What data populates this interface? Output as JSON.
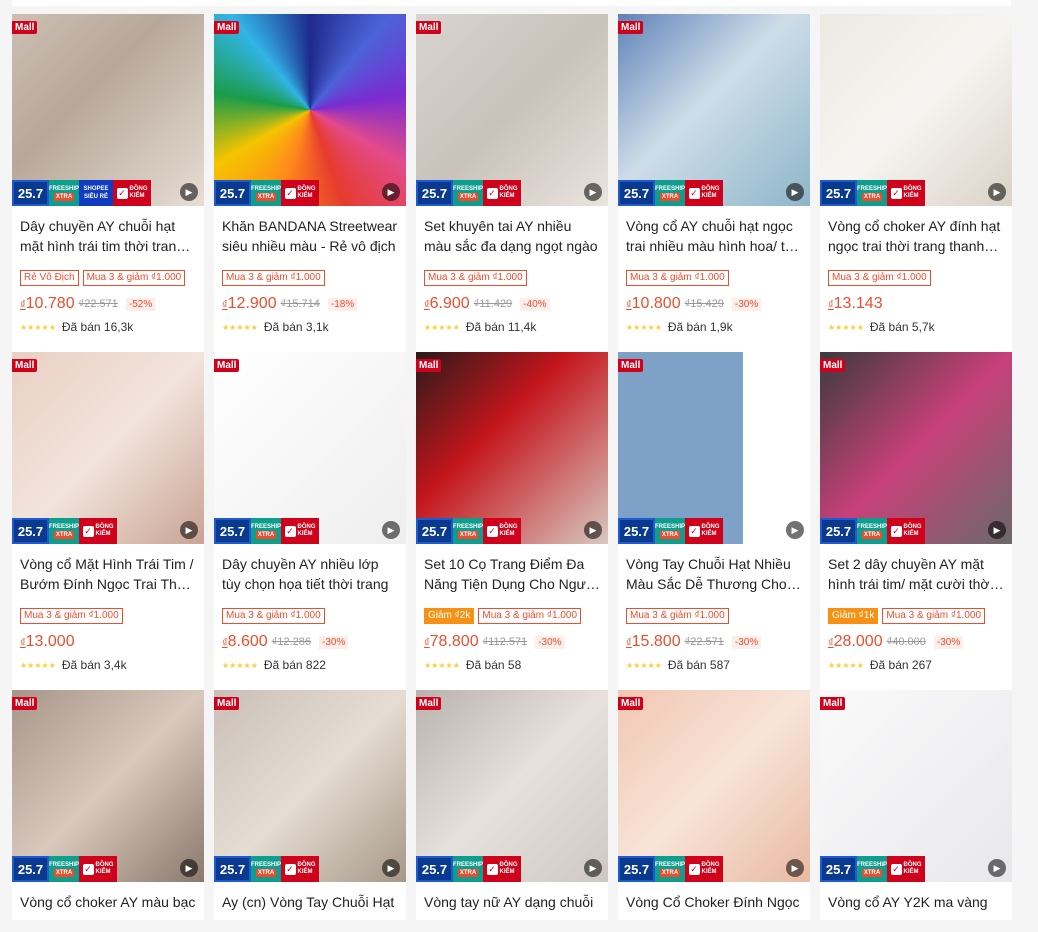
{
  "badges": {
    "mall": "Mall",
    "sale_day": "25.7",
    "freeship_top": "FREESHIP",
    "freeship_bottom": "XTRA",
    "shopee_top": "SHOPEE",
    "shopee_bottom": "SIÊU RẺ",
    "dong_top": "ĐỒNG",
    "dong_bottom": "KIỂM",
    "check": "✓"
  },
  "icons": {
    "play": "play-icon",
    "star": "star-icon"
  },
  "colors": {
    "accent": "#ee4d2d",
    "mall": "#d0011b",
    "star": "#ffce3d"
  },
  "products": [
    {
      "name": "Dây chuyền AY chuỗi hạt mặt hình trái tim thời trang cho nữ",
      "tags": [
        "Rẻ Vô Địch",
        "Mua 3 & giảm ₫1.000"
      ],
      "price": "10.780",
      "old_price": "₫22.571",
      "discount": "-52%",
      "stars": "★★★★★",
      "sold": "Đã bán 16,3k"
    },
    {
      "name": "Khăn BANDANA Streetwear siêu nhiều màu - Rẻ vô địch",
      "tags": [
        "Mua 3 & giảm ₫1.000"
      ],
      "price": "12.900",
      "old_price": "₫15.714",
      "discount": "-18%",
      "stars": "★★★★★",
      "sold": "Đã bán 3,1k"
    },
    {
      "name": "Set khuyên tai AY nhiều màu sắc đa dạng ngọt ngào",
      "tags": [
        "Mua 3 & giảm ₫1.000"
      ],
      "price": "6.900",
      "old_price": "₫11.429",
      "discount": "-40%",
      "stars": "★★★★★",
      "sold": "Đã bán 11,4k"
    },
    {
      "name": "Vòng cổ AY chuỗi hạt ngọc trai nhiều màu hình hoa/ trái tim",
      "tags": [
        "Mua 3 & giảm ₫1.000"
      ],
      "price": "10.800",
      "old_price": "₫15.429",
      "discount": "-30%",
      "stars": "★★★★★",
      "sold": "Đã bán 1,9k"
    },
    {
      "name": "Vòng cổ choker AY đính hạt ngọc trai thời trang thanh lịch",
      "tags": [
        "Mua 3 & giảm ₫1.000"
      ],
      "price": "13.143",
      "old_price": "",
      "discount": "",
      "stars": "★★★★★",
      "sold": "Đã bán 5,7k"
    },
    {
      "name": "Vòng cổ Mặt Hình Trái Tim / Bướm Đính Ngọc Trai Thời Trang",
      "tags": [
        "Mua 3 & giảm ₫1.000"
      ],
      "price": "13.000",
      "old_price": "",
      "discount": "",
      "stars": "★★★★★",
      "sold": "Đã bán 3,4k"
    },
    {
      "name": "Dây chuyền AY nhiều lớp tùy chọn họa tiết thời trang",
      "tags": [
        "Mua 3 & giảm ₫1.000"
      ],
      "price": "8.600",
      "old_price": "₫12.286",
      "discount": "-30%",
      "stars": "★★★★★",
      "sold": "Đã bán 822"
    },
    {
      "name": "Set 10 Cọ Trang Điểm Đa Năng Tiện Dụng Cho Người Mới",
      "tags": [
        "Giảm ₫2k",
        "Mua 3 & giảm ₫1.000"
      ],
      "price": "78.800",
      "old_price": "₫112.571",
      "discount": "-30%",
      "stars": "★★★★★",
      "sold": "Đã bán 58"
    },
    {
      "name": "Vòng Tay Chuỗi Hạt Nhiều Màu Sắc Dễ Thương Cho Nữ",
      "tags": [
        "Mua 3 & giảm ₫1.000"
      ],
      "price": "15.800",
      "old_price": "₫22.571",
      "discount": "-30%",
      "stars": "★★★★★",
      "sold": "Đã bán 587"
    },
    {
      "name": "Set 2 dây chuyền AY mặt hình trái tim/ mặt cười thời trang",
      "tags": [
        "Giảm ₫1k",
        "Mua 3 & giảm ₫1.000"
      ],
      "price": "28.000",
      "old_price": "₫40.000",
      "discount": "-30%",
      "stars": "★★★★★",
      "sold": "Đã bán 267"
    },
    {
      "name": "Vòng cổ choker AY màu bạc",
      "tags": [],
      "price": "",
      "old_price": "",
      "discount": "",
      "stars": "",
      "sold": ""
    },
    {
      "name": "Ay (cn) Vòng Tay Chuỗi Hạt",
      "tags": [],
      "price": "",
      "old_price": "",
      "discount": "",
      "stars": "",
      "sold": ""
    },
    {
      "name": "Vòng tay nữ AY dạng chuỗi",
      "tags": [],
      "price": "",
      "old_price": "",
      "discount": "",
      "stars": "",
      "sold": ""
    },
    {
      "name": "Vòng Cổ Choker Đính Ngọc",
      "tags": [],
      "price": "",
      "old_price": "",
      "discount": "",
      "stars": "",
      "sold": ""
    },
    {
      "name": "Vòng cổ AY Y2K ma vàng",
      "tags": [],
      "price": "",
      "old_price": "",
      "discount": "",
      "stars": "",
      "sold": ""
    }
  ],
  "currency": "₫"
}
